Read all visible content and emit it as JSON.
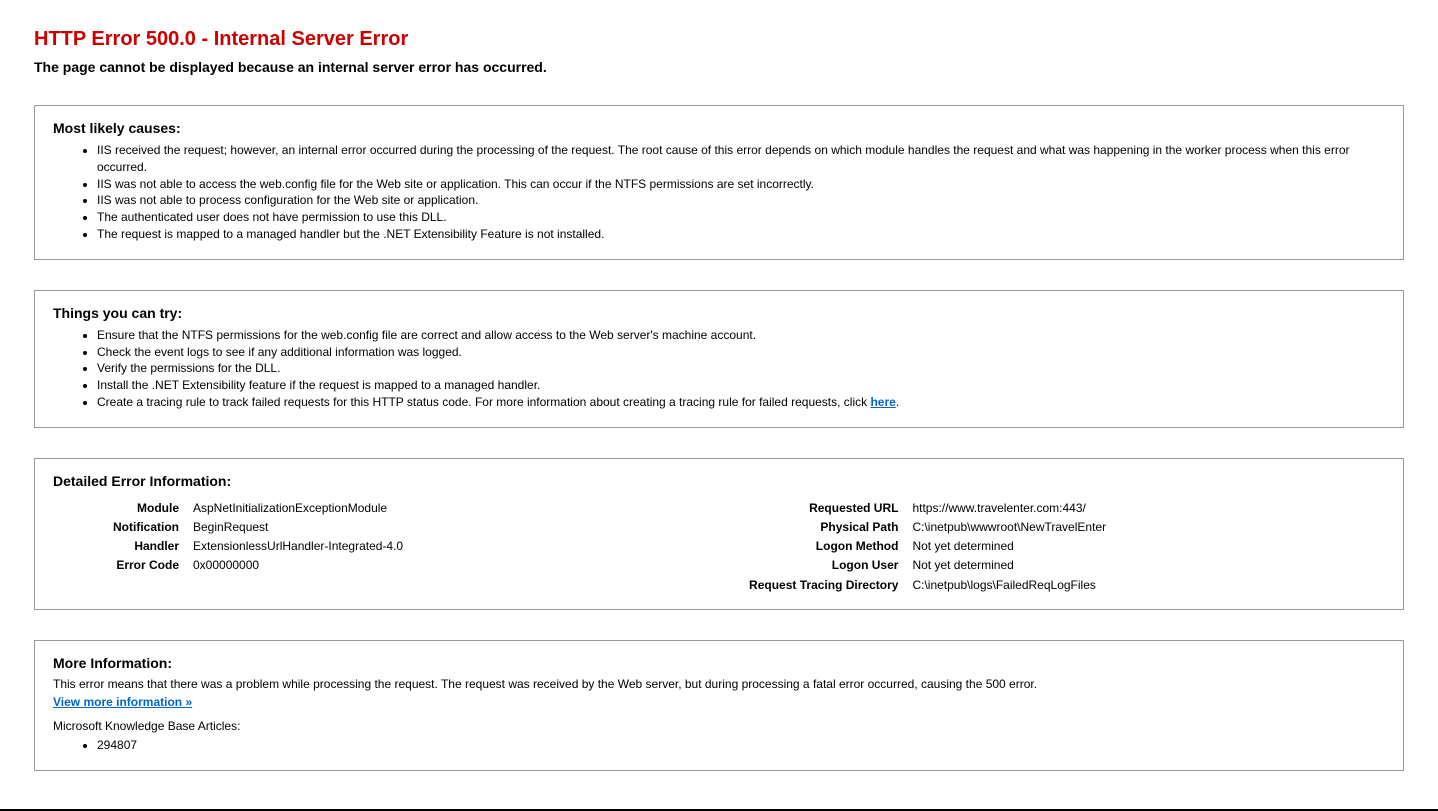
{
  "error": {
    "title": "HTTP Error 500.0 - Internal Server Error",
    "subtitle": "The page cannot be displayed because an internal server error has occurred."
  },
  "causes": {
    "heading": "Most likely causes:",
    "items": [
      "IIS received the request; however, an internal error occurred during the processing of the request. The root cause of this error depends on which module handles the request and what was happening in the worker process when this error occurred.",
      "IIS was not able to access the web.config file for the Web site or application. This can occur if the NTFS permissions are set incorrectly.",
      "IIS was not able to process configuration for the Web site or application.",
      "The authenticated user does not have permission to use this DLL.",
      "The request is mapped to a managed handler but the .NET Extensibility Feature is not installed."
    ]
  },
  "tries": {
    "heading": "Things you can try:",
    "items": [
      "Ensure that the NTFS permissions for the web.config file are correct and allow access to the Web server's machine account.",
      "Check the event logs to see if any additional information was logged.",
      "Verify the permissions for the DLL.",
      "Install the .NET Extensibility feature if the request is mapped to a managed handler."
    ],
    "last_item_prefix": "Create a tracing rule to track failed requests for this HTTP status code. For more information about creating a tracing rule for failed requests, click ",
    "last_item_link": "here",
    "last_item_suffix": "."
  },
  "details": {
    "heading": "Detailed Error Information:",
    "left": [
      {
        "label": "Module",
        "value": "AspNetInitializationExceptionModule"
      },
      {
        "label": "Notification",
        "value": "BeginRequest"
      },
      {
        "label": "Handler",
        "value": "ExtensionlessUrlHandler-Integrated-4.0"
      },
      {
        "label": "Error Code",
        "value": "0x00000000"
      }
    ],
    "right": [
      {
        "label": "Requested URL",
        "value": "https://www.travelenter.com:443/"
      },
      {
        "label": "Physical Path",
        "value": "C:\\inetpub\\wwwroot\\NewTravelEnter"
      },
      {
        "label": "Logon Method",
        "value": "Not yet determined"
      },
      {
        "label": "Logon User",
        "value": "Not yet determined"
      },
      {
        "label": "Request Tracing Directory",
        "value": "C:\\inetpub\\logs\\FailedReqLogFiles"
      }
    ]
  },
  "moreinfo": {
    "heading": "More Information:",
    "text": "This error means that there was a problem while processing the request. The request was received by the Web server, but during processing a fatal error occurred, causing the 500 error.",
    "link": "View more information »",
    "kb_heading": "Microsoft Knowledge Base Articles:",
    "kb_items": [
      "294807"
    ]
  }
}
